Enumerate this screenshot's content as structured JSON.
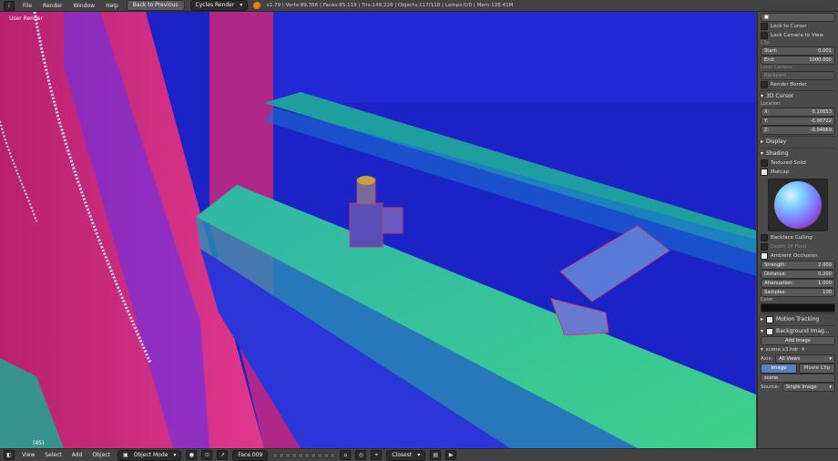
{
  "topbar": {
    "menus": [
      "File",
      "Render",
      "Window",
      "Help"
    ],
    "back_button": "Back to Previous",
    "render_engine": "Cycles Render",
    "stats": "v2.79 | Verts:89,356 | Faces:85,119 | Tris:149,226 | Objects:117/118 | Lamps:0/0 | Mem:128.41M"
  },
  "viewport": {
    "label": "User Render",
    "frame": "(45)"
  },
  "panel": {
    "lock_to_cursor": "Lock to Cursor",
    "lock_camera": "Lock Camera to View",
    "clip_label": "Clip:",
    "clip_start_label": "Start:",
    "clip_start": "0.001",
    "clip_end_label": "End:",
    "clip_end": "1000.000",
    "local_camera_label": "Local Camera:",
    "local_camera": "Backyard",
    "render_border": "Render Border",
    "cursor_header": "3D Cursor",
    "location_label": "Location:",
    "x_label": "X:",
    "x_value": "0.10653",
    "y_label": "Y:",
    "y_value": "-0.00722",
    "z_label": "Z:",
    "z_value": "-0.04669",
    "display_header": "Display",
    "shading_header": "Shading",
    "textured_solid": "Textured Solid",
    "matcap": "Matcap",
    "backface_culling": "Backface Culling",
    "depth_of_field": "Depth Of Field",
    "ambient_occlusion": "Ambient Occlusion",
    "strength_label": "Strength:",
    "strength": "2.000",
    "distance_label": "Distance:",
    "distance": "0.200",
    "attenuation_label": "Attenuation:",
    "attenuation": "1.000",
    "samples_label": "Samples:",
    "samples": "100",
    "color_label": "Color:",
    "motion_tracking": "Motion Tracking",
    "background_images": "Background Imag...",
    "add_image": "Add Image",
    "image_name": "scene.x3.hdr",
    "axis_label": "Axis:",
    "axis_value": "All Views",
    "tab_image": "Image",
    "tab_movie": "Movie Clip",
    "image_field": "scene",
    "source_label": "Source:",
    "source_value": "Single Image"
  },
  "bottombar": {
    "menus": [
      "View",
      "Select",
      "Add",
      "Object"
    ],
    "mode": "Object Mode",
    "face_name": "Face.009",
    "snap": "Closest"
  },
  "colors": {
    "viewport_blue": "#1d23c8",
    "magenta": "#d22a86",
    "green": "#38c88a",
    "accent_orange": "#e87d0d"
  }
}
